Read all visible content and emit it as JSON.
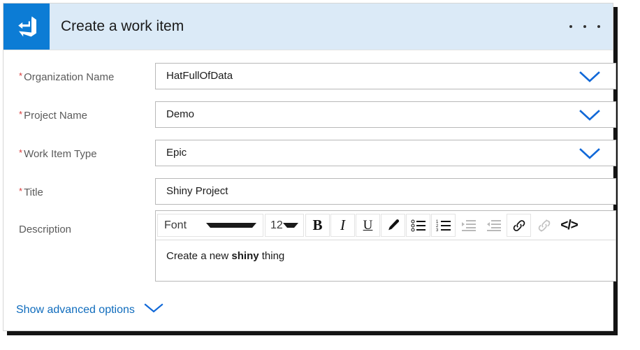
{
  "header": {
    "title": "Create a work item",
    "logo_icon": "azure-devops-logo",
    "more_icon": "ellipsis-icon",
    "background": "#dbeaf7",
    "logo_background": "#0c7cd5"
  },
  "form": {
    "required_marker": "*",
    "rows": [
      {
        "label": "Organization Name",
        "required": true,
        "control": "dropdown",
        "value": "HatFullOfData",
        "name": "organization-name"
      },
      {
        "label": "Project Name",
        "required": true,
        "control": "dropdown",
        "value": "Demo",
        "name": "project-name"
      },
      {
        "label": "Work Item Type",
        "required": true,
        "control": "dropdown",
        "value": "Epic",
        "name": "work-item-type"
      },
      {
        "label": "Title",
        "required": true,
        "control": "text",
        "value": "Shiny Project",
        "name": "title"
      },
      {
        "label": "Description",
        "required": false,
        "control": "richtext",
        "name": "description"
      }
    ]
  },
  "editor": {
    "font_select": {
      "label": "Font",
      "icon": "caret-down-icon"
    },
    "size_select": {
      "label": "12",
      "icon": "caret-down-icon"
    },
    "buttons": [
      {
        "name": "bold-button",
        "icon": "bold-icon",
        "glyph": "B",
        "enabled": true
      },
      {
        "name": "italic-button",
        "icon": "italic-icon",
        "glyph": "I",
        "enabled": true
      },
      {
        "name": "underline-button",
        "icon": "underline-icon",
        "glyph": "U",
        "enabled": true
      },
      {
        "name": "highlight-button",
        "icon": "pen-icon",
        "glyph": "",
        "enabled": true
      },
      {
        "name": "bulleted-list-button",
        "icon": "bulleted-list-icon",
        "glyph": "",
        "enabled": true
      },
      {
        "name": "numbered-list-button",
        "icon": "numbered-list-icon",
        "glyph": "",
        "enabled": true
      },
      {
        "name": "indent-button",
        "icon": "indent-icon",
        "glyph": "",
        "enabled": false
      },
      {
        "name": "outdent-button",
        "icon": "outdent-icon",
        "glyph": "",
        "enabled": false
      },
      {
        "name": "link-button",
        "icon": "link-icon",
        "glyph": "",
        "enabled": true
      },
      {
        "name": "unlink-button",
        "icon": "unlink-icon",
        "glyph": "",
        "enabled": false
      },
      {
        "name": "code-button",
        "icon": "code-icon",
        "glyph": "</>",
        "enabled": true
      }
    ],
    "body": {
      "before": "Create a new ",
      "bold": "shiny",
      "after": " thing"
    }
  },
  "advanced": {
    "label": "Show advanced options",
    "icon": "chevron-down-icon"
  },
  "colors": {
    "accent_blue": "#0f6cbd",
    "chevron_blue": "#1068d8",
    "required_red": "#d83b3b",
    "field_border": "#b8b8b8",
    "label_text": "#5b5b5b"
  }
}
